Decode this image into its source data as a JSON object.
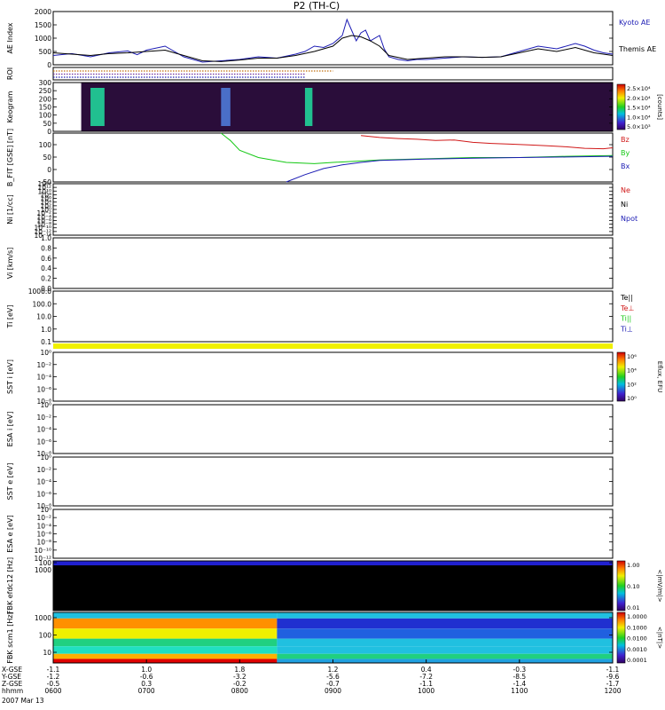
{
  "title": "P2 (TH-C)",
  "date_label": "2007 Mar 13",
  "time_axis": {
    "rows": [
      {
        "label": "X-GSE",
        "values": [
          "-1.1",
          "1.0",
          "1.8",
          "1.2",
          "0.4",
          "-0.3",
          "-1.1"
        ]
      },
      {
        "label": "Y-GSE",
        "values": [
          "-1.2",
          "-0.6",
          "-3.2",
          "-5.6",
          "-7.2",
          "-8.5",
          "-9.6"
        ]
      },
      {
        "label": "Z-GSE",
        "values": [
          "-0.5",
          "0.3",
          "-0.2",
          "-0.7",
          "-1.1",
          "-1.4",
          "-1.7"
        ]
      },
      {
        "label": "hhmm",
        "values": [
          "0600",
          "0700",
          "0800",
          "0900",
          "1000",
          "1100",
          "1200"
        ]
      }
    ]
  },
  "chart_data": [
    {
      "type": "line",
      "id": "ae",
      "ylabel": "AE Index",
      "ylim": [
        0,
        2000
      ],
      "yticks": [
        "0",
        "500",
        "1000",
        "1500",
        "2000"
      ],
      "series": [
        {
          "name": "Kyoto AE",
          "color": "#1c1cb4",
          "x": [
            6.0,
            6.2,
            6.4,
            6.6,
            6.8,
            6.9,
            7.0,
            7.2,
            7.4,
            7.6,
            7.8,
            8.0,
            8.2,
            8.4,
            8.6,
            8.7,
            8.8,
            8.9,
            9.0,
            9.1,
            9.15,
            9.2,
            9.25,
            9.3,
            9.35,
            9.4,
            9.5,
            9.55,
            9.6,
            9.7,
            9.8,
            9.9,
            10.0,
            10.2,
            10.4,
            10.6,
            10.8,
            11.0,
            11.2,
            11.4,
            11.6,
            11.7,
            11.8,
            11.9,
            12.0
          ],
          "y": [
            350,
            420,
            300,
            450,
            520,
            380,
            550,
            700,
            300,
            100,
            150,
            200,
            300,
            250,
            400,
            500,
            700,
            650,
            800,
            1100,
            1700,
            1300,
            900,
            1200,
            1300,
            900,
            1100,
            600,
            300,
            200,
            150,
            200,
            200,
            250,
            300,
            280,
            300,
            500,
            700,
            600,
            800,
            700,
            550,
            450,
            400
          ]
        },
        {
          "name": "Themis AE",
          "color": "#000000",
          "x": [
            6.0,
            6.2,
            6.4,
            6.6,
            6.8,
            7.0,
            7.2,
            7.4,
            7.6,
            7.8,
            8.0,
            8.2,
            8.4,
            8.6,
            8.8,
            9.0,
            9.1,
            9.2,
            9.3,
            9.4,
            9.5,
            9.6,
            9.8,
            10.0,
            10.2,
            10.4,
            10.6,
            10.8,
            11.0,
            11.2,
            11.4,
            11.6,
            11.8,
            12.0
          ],
          "y": [
            450,
            400,
            350,
            420,
            450,
            500,
            550,
            350,
            150,
            120,
            180,
            250,
            250,
            350,
            500,
            700,
            1000,
            1100,
            1050,
            900,
            700,
            350,
            200,
            250,
            300,
            300,
            280,
            300,
            450,
            600,
            500,
            650,
            450,
            350
          ]
        }
      ]
    },
    {
      "type": "table",
      "id": "roi",
      "ylabel": "ROI",
      "rows": [
        {
          "color": "#c07010",
          "x": [
            6.0,
            9.0
          ]
        },
        {
          "color": "#7030a0",
          "x": [
            6.0,
            8.7
          ]
        },
        {
          "color": "#1c1cb4",
          "x": [
            6.0,
            8.7
          ]
        }
      ]
    },
    {
      "type": "heatmap",
      "id": "keogram",
      "ylabel": "Keogram",
      "ylim": [
        0,
        300
      ],
      "yticks": [
        "0",
        "50",
        "100",
        "150",
        "200",
        "250",
        "300"
      ],
      "colorbar_label": "[counts]",
      "colorbar_ticks": [
        "5.0×10³",
        "1.0×10⁴",
        "1.5×10⁴",
        "2.0×10⁴",
        "2.5×10⁴"
      ],
      "bright_bands": [
        {
          "x": [
            6.4,
            6.55
          ],
          "level": 0.8
        },
        {
          "x": [
            7.8,
            7.9
          ],
          "level": 0.5
        },
        {
          "x": [
            8.7,
            8.78
          ],
          "level": 0.7
        }
      ],
      "data_x": [
        6.3,
        12.0
      ]
    },
    {
      "type": "line",
      "id": "bfit",
      "ylabel": "B_FIT [GSE] [nT]",
      "ylim": [
        -100,
        100
      ],
      "yticks": [
        "-50",
        "0",
        "50",
        "100"
      ],
      "series": [
        {
          "name": "Bz",
          "color": "#d01818",
          "x": [
            9.3,
            9.5,
            9.7,
            9.9,
            10.1,
            10.3,
            10.5,
            10.7,
            10.9,
            11.1,
            11.3,
            11.5,
            11.7,
            11.9,
            12.0
          ],
          "y": [
            90,
            82,
            78,
            75,
            70,
            72,
            62,
            58,
            55,
            52,
            48,
            44,
            38,
            36,
            40
          ]
        },
        {
          "name": "By",
          "color": "#14c814",
          "x": [
            7.8,
            7.9,
            8.0,
            8.2,
            8.5,
            8.8,
            9.0,
            9.5,
            10.0,
            10.5,
            11.0,
            11.5,
            12.0
          ],
          "y": [
            100,
            70,
            30,
            0,
            -20,
            -25,
            -20,
            -10,
            -5,
            0,
            0,
            5,
            8
          ]
        },
        {
          "name": "Bx",
          "color": "#1c1cb4",
          "x": [
            8.5,
            8.7,
            8.9,
            9.1,
            9.3,
            9.5,
            10.0,
            10.5,
            11.0,
            11.5,
            12.0
          ],
          "y": [
            -100,
            -70,
            -45,
            -30,
            -20,
            -12,
            -6,
            -3,
            0,
            2,
            5
          ]
        }
      ]
    },
    {
      "type": "line",
      "id": "ni",
      "ylabel": "Ni [1/cc]",
      "ylim_label": "log",
      "yticks": [
        "10⁻¹⁴",
        "10⁻¹²",
        "10⁻¹⁰",
        "10⁻⁸",
        "10⁻⁶",
        "10⁻⁴",
        "10⁻²",
        "10⁰",
        "10²",
        "10⁴",
        "10⁶",
        "10⁸",
        "10¹⁰",
        "10¹²",
        "10¹⁴"
      ],
      "series": [
        {
          "name": "Ne",
          "color": "#d01818"
        },
        {
          "name": "Ni",
          "color": "#000000"
        },
        {
          "name": "Npot",
          "color": "#1c1cb4"
        }
      ]
    },
    {
      "type": "line",
      "id": "vi",
      "ylabel": "Vi [km/s]",
      "yticks": [
        "0.0",
        "0.2",
        "0.4",
        "0.6",
        "0.8",
        "1.0"
      ],
      "series": []
    },
    {
      "type": "line",
      "id": "ti",
      "ylabel": "Ti [eV]",
      "yticks": [
        "0.1",
        "1.0",
        "10.0",
        "100.0",
        "1000.0"
      ],
      "series": [
        {
          "name": "Te||",
          "color": "#000000"
        },
        {
          "name": "Te⊥",
          "color": "#d01818"
        },
        {
          "name": "Ti||",
          "color": "#14c814"
        },
        {
          "name": "Ti⊥",
          "color": "#1c1cb4"
        }
      ]
    },
    {
      "type": "heatmap",
      "id": "sst_i",
      "ylabel": "SST i [eV]",
      "yticks": [
        "10⁻⁸",
        "10⁻⁶",
        "10⁻⁴",
        "10⁻²",
        "10⁰"
      ],
      "colorbar_label": "Eflux, EFU",
      "colorbar_ticks": [
        "10⁰",
        "10²",
        "10⁴",
        "10⁶"
      ]
    },
    {
      "type": "heatmap",
      "id": "esa_i",
      "ylabel": "ESA i [eV]",
      "yticks": [
        "10⁻⁸",
        "10⁻⁶",
        "10⁻⁴",
        "10⁻²",
        "10⁰"
      ]
    },
    {
      "type": "heatmap",
      "id": "sst_e",
      "ylabel": "SST e [eV]",
      "yticks": [
        "10⁻⁸",
        "10⁻⁶",
        "10⁻⁴",
        "10⁻²",
        "10⁰"
      ]
    },
    {
      "type": "heatmap",
      "id": "esa_e",
      "ylabel": "ESA e [eV]",
      "yticks": [
        "10⁻¹²",
        "10⁻¹⁰",
        "10⁻⁸",
        "10⁻⁶",
        "10⁻⁴",
        "10⁻²",
        "10⁰"
      ]
    },
    {
      "type": "heatmap",
      "id": "fbk_e12",
      "ylabel": "FBK efdc12 [Hz]",
      "yticks": [
        "100",
        "1000"
      ],
      "colorbar_label": "<|mV/m|>",
      "colorbar_ticks": [
        "0.01",
        "0.10",
        "1.00"
      ]
    },
    {
      "type": "heatmap",
      "id": "fbk_scm",
      "ylabel": "FBK scm1 [Hz]",
      "yticks": [
        "10",
        "100",
        "1000"
      ],
      "colorbar_label": "<|nT|>",
      "colorbar_ticks": [
        "0.0001",
        "0.0010",
        "0.0100",
        "0.1000",
        "1.0000"
      ]
    }
  ]
}
